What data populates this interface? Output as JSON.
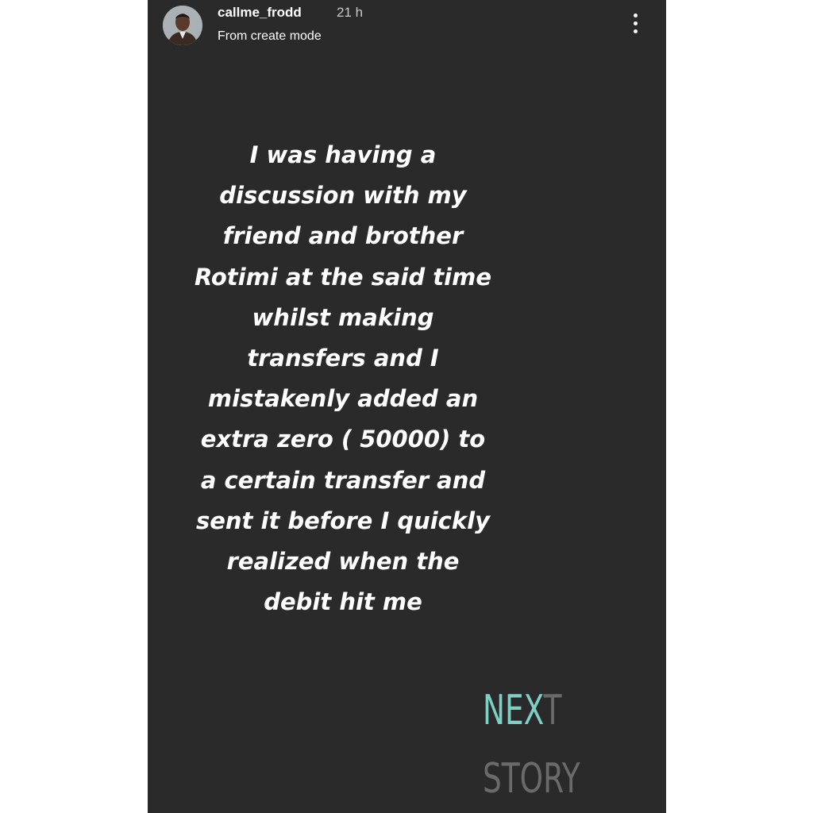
{
  "header": {
    "username": "callme_frodd",
    "time_ago": "21 h",
    "subtitle": "From create mode",
    "more_icon": "vertical-ellipsis-icon"
  },
  "story": {
    "lines": [
      "I was having a",
      "discussion with my",
      "friend and brother",
      "Rotimi at the said time",
      "whilst making",
      "transfers and I",
      "mistakenly added an",
      "extra zero ( 50000) to",
      "a certain transfer and",
      "sent it before I  quickly",
      "realized when the",
      "debit hit me"
    ]
  },
  "next_story": {
    "word1_highlight": "NEX",
    "word1_rest": "T",
    "word2": "STORY"
  },
  "colors": {
    "background": "#2a2a2a",
    "accent": "#7ed0c4",
    "muted": "#6a6a6a",
    "text": "#ffffff"
  }
}
